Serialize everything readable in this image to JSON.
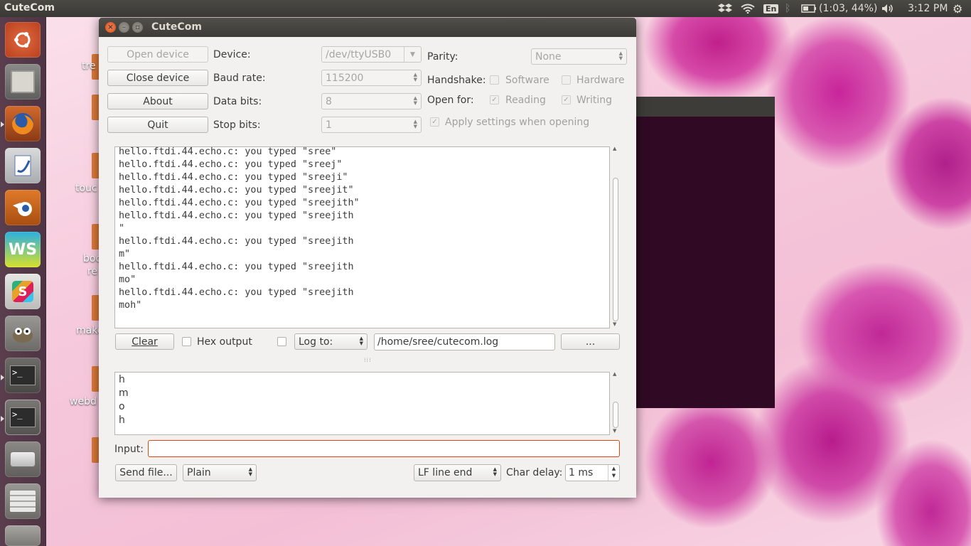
{
  "top_panel": {
    "app_name": "CuteCom",
    "keyboard_layout": "En",
    "battery_status": "(1:03, 44%)",
    "clock": "3:12 PM"
  },
  "launcher": {
    "items": [
      "ubuntu-dash-icon",
      "files-icon",
      "firefox-icon",
      "libreoffice-icon",
      "blender-icon",
      "webstorm-icon",
      "slack-icon",
      "gimp-icon",
      "terminal-icon",
      "terminal-icon",
      "drive-icon",
      "workspace-icon"
    ]
  },
  "desktop": {
    "labels": [
      "tre",
      "touc",
      "boo",
      "re",
      "make",
      "webd"
    ]
  },
  "window": {
    "title": "CuteCom",
    "buttons": {
      "open_device": "Open device",
      "close_device": "Close device",
      "about": "About",
      "quit": "Quit"
    },
    "settings": {
      "device_label": "Device:",
      "device_value": "/dev/ttyUSB0",
      "baud_label": "Baud rate:",
      "baud_value": "115200",
      "data_bits_label": "Data bits:",
      "data_bits_value": "8",
      "stop_bits_label": "Stop bits:",
      "stop_bits_value": "1",
      "parity_label": "Parity:",
      "parity_value": "None",
      "handshake_label": "Handshake:",
      "software_label": "Software",
      "hardware_label": "Hardware",
      "open_for_label": "Open for:",
      "reading_label": "Reading",
      "writing_label": "Writing",
      "apply_label": "Apply settings when opening"
    },
    "output_lines": [
      "hello.ftdi.44.echo.c: you typed \"sree\"",
      "hello.ftdi.44.echo.c: you typed \"sreej\"",
      "hello.ftdi.44.echo.c: you typed \"sreeji\"",
      "hello.ftdi.44.echo.c: you typed \"sreejit\"",
      "hello.ftdi.44.echo.c: you typed \"sreejith\"",
      "hello.ftdi.44.echo.c: you typed \"sreejith",
      "\"",
      "hello.ftdi.44.echo.c: you typed \"sreejith",
      "m\"",
      "hello.ftdi.44.echo.c: you typed \"sreejith",
      "mo\"",
      "hello.ftdi.44.echo.c: you typed \"sreejith",
      "moh\""
    ],
    "log_bar": {
      "clear": "Clear",
      "hex_output": "Hex output",
      "log_to": "Log to:",
      "log_path": "/home/sree/cutecom.log",
      "browse": "..."
    },
    "history": [
      "h",
      "m",
      "o",
      "h"
    ],
    "input_label": "Input:",
    "input_value": "",
    "bottom": {
      "send_file": "Send file...",
      "mode": "Plain",
      "line_end": "LF line end",
      "char_delay_label": "Char delay:",
      "char_delay_value": "1 ms"
    }
  }
}
